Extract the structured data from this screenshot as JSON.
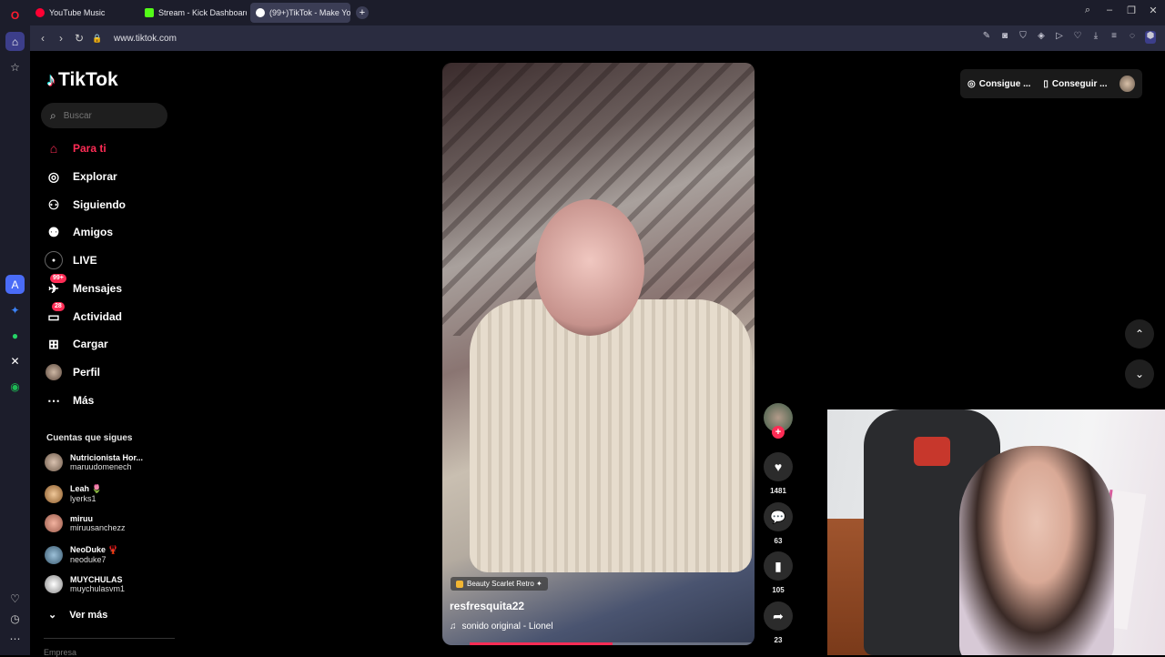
{
  "browser": {
    "tabs": [
      {
        "label": "YouTube Music",
        "color": "#ff0033"
      },
      {
        "label": "Stream - Kick Dashboard",
        "color": "#53fc18"
      },
      {
        "label": "(99+)TikTok - Make Your Day",
        "color": "#ffffff"
      }
    ],
    "url": "www.tiktok.com"
  },
  "sidebar": {
    "logo_text": "TikTok",
    "search_placeholder": "Buscar",
    "nav": [
      {
        "label": "Para ti",
        "icon": "home-icon"
      },
      {
        "label": "Explorar",
        "icon": "compass-icon"
      },
      {
        "label": "Siguiendo",
        "icon": "following-icon"
      },
      {
        "label": "Amigos",
        "icon": "friends-icon"
      },
      {
        "label": "LIVE",
        "icon": "live-icon"
      },
      {
        "label": "Mensajes",
        "icon": "messages-icon",
        "badge": "99+"
      },
      {
        "label": "Actividad",
        "icon": "activity-icon",
        "badge": "28"
      },
      {
        "label": "Cargar",
        "icon": "upload-icon"
      },
      {
        "label": "Perfil",
        "icon": "profile-icon"
      },
      {
        "label": "Más",
        "icon": "more-icon"
      }
    ],
    "following_title": "Cuentas que sigues",
    "following": [
      {
        "name": "Nutricionista Hor...",
        "handle": "maruudomenech"
      },
      {
        "name": "Leah 🌷",
        "handle": "lyerks1"
      },
      {
        "name": "miruu",
        "handle": "miruusanchezz"
      },
      {
        "name": "NeoDuke 🦞",
        "handle": "neoduke7"
      },
      {
        "name": "MUYCHULAS",
        "handle": "muychulasvm1"
      }
    ],
    "see_more": "Ver más",
    "footer_section": "Empresa"
  },
  "video": {
    "effect_tag": "Beauty Scarlet Retro ✦",
    "username": "resfresquita22",
    "sound": "sonido original - Lionel",
    "progress": 0.5,
    "likes": "1481",
    "comments": "63",
    "saves": "105",
    "shares": "23"
  },
  "header": {
    "coins_label": "Consigue ...",
    "app_label": "Conseguir ..."
  },
  "colors": {
    "accent": "#fe2c55",
    "rail": "#1c1d2b"
  }
}
